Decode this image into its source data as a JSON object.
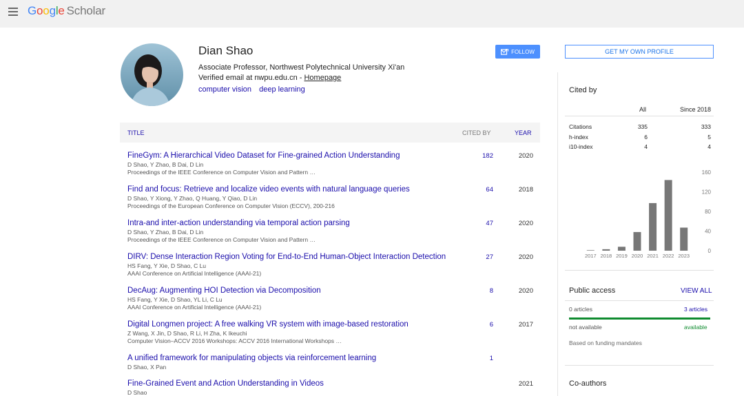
{
  "header": {
    "logo_letters": [
      "G",
      "o",
      "o",
      "g",
      "l",
      "e"
    ],
    "logo_product": "Scholar",
    "menu_icon": "hamburger-menu-icon"
  },
  "profile": {
    "name": "Dian Shao",
    "affiliation": "Associate Professor, Northwest Polytechnical University Xi'an",
    "email_text": "Verified email at nwpu.edu.cn - ",
    "homepage_label": "Homepage",
    "interests": [
      "computer vision",
      "deep learning"
    ],
    "follow_label": "FOLLOW",
    "follow_icon": "envelope-follow-icon"
  },
  "table": {
    "col_title": "TITLE",
    "col_cited": "CITED BY",
    "col_year": "YEAR",
    "rows": [
      {
        "title": "FineGym: A Hierarchical Video Dataset for Fine-grained Action Understanding",
        "authors": "D Shao, Y Zhao, B Dai, D Lin",
        "venue": "Proceedings of the IEEE Conference on Computer Vision and Pattern …",
        "cited": "182",
        "year": "2020"
      },
      {
        "title": "Find and focus: Retrieve and localize video events with natural language queries",
        "authors": "D Shao, Y Xiong, Y Zhao, Q Huang, Y Qiao, D Lin",
        "venue": "Proceedings of the European Conference on Computer Vision (ECCV), 200-216",
        "cited": "64",
        "year": "2018"
      },
      {
        "title": "Intra-and inter-action understanding via temporal action parsing",
        "authors": "D Shao, Y Zhao, B Dai, D Lin",
        "venue": "Proceedings of the IEEE Conference on Computer Vision and Pattern …",
        "cited": "47",
        "year": "2020"
      },
      {
        "title": "DIRV: Dense Interaction Region Voting for End-to-End Human-Object Interaction Detection",
        "authors": "HS Fang, Y Xie, D Shao, C Lu",
        "venue": "AAAI Conference on Artificial Intelligence (AAAI-21)",
        "cited": "27",
        "year": "2020"
      },
      {
        "title": "DecAug: Augmenting HOI Detection via Decomposition",
        "authors": "HS Fang, Y Xie, D Shao, YL Li, C Lu",
        "venue": "AAAI Conference on Artificial Intelligence (AAAI-21)",
        "cited": "8",
        "year": "2020"
      },
      {
        "title": "Digital Longmen project: A free walking VR system with image-based restoration",
        "authors": "Z Wang, X Jin, D Shao, R Li, H Zha, K Ikeuchi",
        "venue": "Computer Vision–ACCV 2016 Workshops: ACCV 2016 International Workshops …",
        "cited": "6",
        "year": "2017"
      },
      {
        "title": "A unified framework for manipulating objects via reinforcement learning",
        "authors": "D Shao, X Pan",
        "venue": "",
        "cited": "1",
        "year": ""
      },
      {
        "title": "Fine-Grained Event and Action Understanding in Videos",
        "authors": "D Shao",
        "venue": "",
        "cited": "",
        "year": "2021"
      }
    ]
  },
  "sidebar": {
    "own_profile_label": "GET MY OWN PROFILE",
    "cited_by_title": "Cited by",
    "col_all": "All",
    "col_since": "Since 2018",
    "stats": [
      {
        "label": "Citations",
        "all": "335",
        "since": "333"
      },
      {
        "label": "h-index",
        "all": "6",
        "since": "5"
      },
      {
        "label": "i10-index",
        "all": "4",
        "since": "4"
      }
    ],
    "public_access_title": "Public access",
    "view_all_label": "VIEW ALL",
    "pa_not_available_count": "0 articles",
    "pa_available_count": "3 articles",
    "pa_not_available_label": "not available",
    "pa_available_label": "available",
    "pa_note": "Based on funding mandates",
    "pa_available_fraction": 1.0,
    "coauthors_title": "Co-authors",
    "colors": {
      "accent": "#4d90fe",
      "link": "#1a0dab",
      "bar": "#777777",
      "available": "#0f8b2f"
    }
  },
  "chart_data": {
    "type": "bar",
    "categories": [
      "2017",
      "2018",
      "2019",
      "2020",
      "2021",
      "2022",
      "2023"
    ],
    "values": [
      1,
      3,
      8,
      38,
      97,
      144,
      47
    ],
    "ylim": [
      0,
      160
    ],
    "yticks": [
      "0",
      "40",
      "80",
      "120",
      "160"
    ],
    "grid": false
  }
}
